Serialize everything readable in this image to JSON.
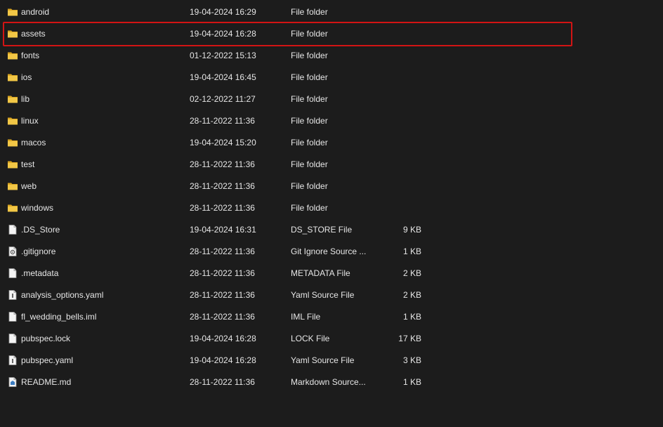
{
  "files": [
    {
      "name": "android",
      "date": "19-04-2024 16:29",
      "type": "File folder",
      "size": "",
      "icon": "folder-icon"
    },
    {
      "name": "assets",
      "date": "19-04-2024 16:28",
      "type": "File folder",
      "size": "",
      "icon": "folder-icon"
    },
    {
      "name": "fonts",
      "date": "01-12-2022 15:13",
      "type": "File folder",
      "size": "",
      "icon": "folder-icon"
    },
    {
      "name": "ios",
      "date": "19-04-2024 16:45",
      "type": "File folder",
      "size": "",
      "icon": "folder-icon"
    },
    {
      "name": "lib",
      "date": "02-12-2022 11:27",
      "type": "File folder",
      "size": "",
      "icon": "folder-icon"
    },
    {
      "name": "linux",
      "date": "28-11-2022 11:36",
      "type": "File folder",
      "size": "",
      "icon": "folder-icon"
    },
    {
      "name": "macos",
      "date": "19-04-2024 15:20",
      "type": "File folder",
      "size": "",
      "icon": "folder-icon"
    },
    {
      "name": "test",
      "date": "28-11-2022 11:36",
      "type": "File folder",
      "size": "",
      "icon": "folder-icon"
    },
    {
      "name": "web",
      "date": "28-11-2022 11:36",
      "type": "File folder",
      "size": "",
      "icon": "folder-icon"
    },
    {
      "name": "windows",
      "date": "28-11-2022 11:36",
      "type": "File folder",
      "size": "",
      "icon": "folder-icon"
    },
    {
      "name": ".DS_Store",
      "date": "19-04-2024 16:31",
      "type": "DS_STORE File",
      "size": "9 KB",
      "icon": "file-icon"
    },
    {
      "name": ".gitignore",
      "date": "28-11-2022 11:36",
      "type": "Git Ignore Source ...",
      "size": "1 KB",
      "icon": "gear-file-icon"
    },
    {
      "name": ".metadata",
      "date": "28-11-2022 11:36",
      "type": "METADATA File",
      "size": "2 KB",
      "icon": "file-icon"
    },
    {
      "name": "analysis_options.yaml",
      "date": "28-11-2022 11:36",
      "type": "Yaml Source File",
      "size": "2 KB",
      "icon": "yaml-file-icon"
    },
    {
      "name": "fl_wedding_bells.iml",
      "date": "28-11-2022 11:36",
      "type": "IML File",
      "size": "1 KB",
      "icon": "file-icon"
    },
    {
      "name": "pubspec.lock",
      "date": "19-04-2024 16:28",
      "type": "LOCK File",
      "size": "17 KB",
      "icon": "file-icon"
    },
    {
      "name": "pubspec.yaml",
      "date": "19-04-2024 16:28",
      "type": "Yaml Source File",
      "size": "3 KB",
      "icon": "yaml-file-icon"
    },
    {
      "name": "README.md",
      "date": "28-11-2022 11:36",
      "type": "Markdown Source...",
      "size": "1 KB",
      "icon": "markdown-file-icon"
    }
  ],
  "highlighted_item": "assets",
  "colors": {
    "background": "#1c1c1c",
    "text": "#e6e6e6",
    "folder": "#f0c040",
    "highlight": "#d21414"
  }
}
